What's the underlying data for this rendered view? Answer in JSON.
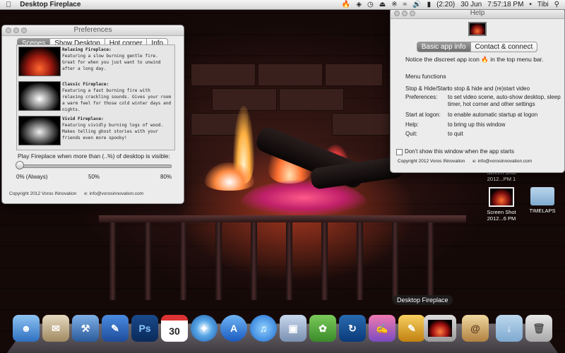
{
  "menubar": {
    "app_name": "Desktop Fireplace",
    "battery": "(2:20)",
    "date": "30 Jun",
    "time": "7:57:18 PM",
    "user": "Tibi"
  },
  "preferences": {
    "title": "Preferences",
    "tabs": [
      "Scenes",
      "Show Desktop",
      "Hot corner",
      "Info"
    ],
    "active_tab": "Scenes",
    "scenes": [
      {
        "title": "Relaxing Fireplace:",
        "desc": "Featuring a slow burning gentle fire. Great for when you just want to unwind after a long day."
      },
      {
        "title": "Classic Fireplace:",
        "desc": "Featuring a fast burning fire with relaxing crackling sounds. Gives your room a warm feel for those cold winter days and nights."
      },
      {
        "title": "Vivid Fireplace:",
        "desc": "Featuring vividly burning logs of wood. Makes telling ghost stories with your friends even more spooky!"
      }
    ],
    "slider_label": "Play Fireplace when more than (..%) of desktop is visible:",
    "slider_ticks": [
      "0% (Always)",
      "50%",
      "80%"
    ],
    "slider_value": 0,
    "copyright": "Copyright 2012 Voros INnovation",
    "email": "e: info@vorosinnovation.com"
  },
  "help": {
    "title": "Help",
    "tabs": [
      "Basic app info",
      "Contact & connect"
    ],
    "active_tab": "Basic app info",
    "notice": "Notice the discreet app icon",
    "notice_tail": "in the top menu bar.",
    "section": "Menu functions",
    "rows": [
      {
        "label": "Stop & Hide/Start",
        "desc": "to stop & hide and (re)start video"
      },
      {
        "label": "Preferences:",
        "desc": "to set video scene, auto-show desktop, sleep timer, hot corner and other settings"
      },
      {
        "label": "Start at logon:",
        "desc": "to enable automatic startup at logon"
      },
      {
        "label": "Help:",
        "desc": "to bring up this window"
      },
      {
        "label": "Quit:",
        "desc": "to quit"
      }
    ],
    "checkbox_label": "Don't show this window when the app starts",
    "checkbox_checked": false,
    "copyright": "Copyright 2012 Voros INnovation",
    "email": "e: info@vorosinnovation.com"
  },
  "desktop_icons": [
    {
      "label": "Screen Shot 2012...PM 1",
      "type": "screenshot"
    },
    {
      "label": "Screen Shot 2012...6 PM",
      "type": "screenshot"
    },
    {
      "label": "TIMELAPS",
      "type": "folder"
    }
  ],
  "dock": {
    "tooltip": "Desktop Fireplace",
    "calendar_day": "30",
    "ps_label": "Ps",
    "items": [
      "finder",
      "mail",
      "xcode",
      "app-store-dev",
      "photoshop",
      "calendar",
      "safari",
      "app-store",
      "itunes",
      "preview",
      "evernote",
      "chrome-like",
      "textwrangler",
      "desktop-fireplace",
      "address-book",
      "downloads",
      "trash"
    ]
  }
}
